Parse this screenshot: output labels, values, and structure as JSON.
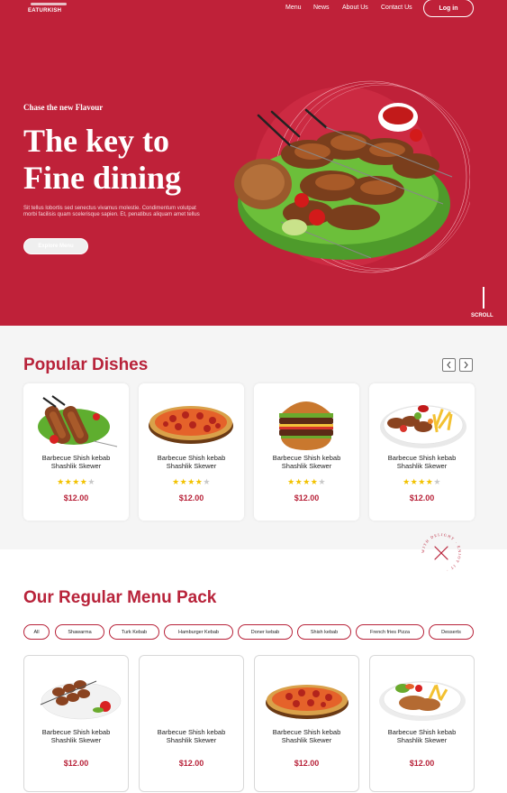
{
  "header": {
    "logo_text": "EATURKISH",
    "nav": [
      "Menu",
      "News",
      "About Us",
      "Contact Us"
    ],
    "login_label": "Log in"
  },
  "hero": {
    "kicker": "Chase the new Flavour",
    "headline": "The key to\nFine dining",
    "description": "Sit tellus lobortis sed senectus vivamus molestie. Condimentum volutpat morbi facilisis quam scelerisque sapien. Et, penatibus aliquam amet tellus",
    "cta_label": "Explore Menu",
    "scroll_label": "SCROLL"
  },
  "popular": {
    "title": "Popular Dishes",
    "prev_icon": "chevron-left-icon",
    "next_icon": "chevron-right-icon",
    "items": [
      {
        "name": "Barbecue Shish kebab\nShashlik Skewer",
        "rating": 4,
        "price": "$12.00",
        "image": "kebab-skewers"
      },
      {
        "name": "Barbecue Shish kebab\nShashlik Skewer",
        "rating": 4,
        "price": "$12.00",
        "image": "pepperoni-pizza"
      },
      {
        "name": "Barbecue Shish kebab\nShashlik Skewer",
        "rating": 4,
        "price": "$12.00",
        "image": "burger"
      },
      {
        "name": "Barbecue Shish kebab\nShashlik Skewer",
        "rating": 4,
        "price": "$12.00",
        "image": "kebab-platter"
      }
    ]
  },
  "stamp": {
    "text": "WITH DELIGHT · ENJOY IT ·",
    "icon": "crossed-utensils-icon"
  },
  "menu_pack": {
    "title": "Our Regular Menu Pack",
    "filters": [
      "All",
      "Shawarma",
      "Turk Kebab",
      "Hamburger Kebab",
      "Doner kebab",
      "Shish kebab",
      "French fries Pizza",
      "Desserts"
    ],
    "items": [
      {
        "name": "Barbecue Shish kebab\nShashlik Skewer",
        "price": "$12.00",
        "image": "kebab-skewers-plate"
      },
      {
        "name": "Barbecue Shish kebab\nShashlik Skewer",
        "price": "$12.00",
        "image": "none"
      },
      {
        "name": "Barbecue Shish kebab\nShashlik Skewer",
        "price": "$12.00",
        "image": "pepperoni-pizza"
      },
      {
        "name": "Barbecue Shish kebab\nShashlik Skewer",
        "price": "$12.00",
        "image": "doner-plate"
      }
    ]
  },
  "colors": {
    "brand": "#bf2139",
    "accent_text": "#b8233a",
    "star": "#f2c200"
  }
}
